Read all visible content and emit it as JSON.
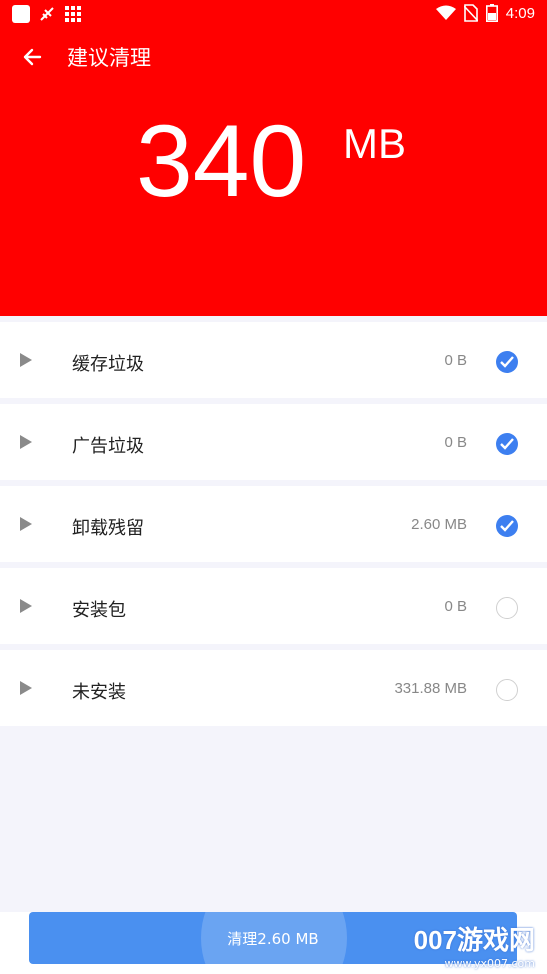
{
  "status_bar": {
    "time": "4:09",
    "icons": [
      "app-square-icon",
      "notification-icon",
      "grid-icon",
      "wifi-icon",
      "no-sim-icon",
      "battery-icon"
    ]
  },
  "header": {
    "title": "建议清理",
    "back_icon": "arrow-left-icon",
    "size_value": "340",
    "size_unit": "MB",
    "background_color": "#ff0000"
  },
  "items": [
    {
      "label": "缓存垃圾",
      "size": "0 B",
      "checked": true
    },
    {
      "label": "广告垃圾",
      "size": "0 B",
      "checked": true
    },
    {
      "label": "卸载残留",
      "size": "2.60 MB",
      "checked": true
    },
    {
      "label": "安装包",
      "size": "0 B",
      "checked": false
    },
    {
      "label": "未安装",
      "size": "331.88 MB",
      "checked": false
    }
  ],
  "clean_button": {
    "label": "清理2.60 MB",
    "color": "#4a90f0"
  },
  "watermark": {
    "main": "007游戏网",
    "sub": "www.yx007.com"
  },
  "accent_color": "#3d7ff0"
}
